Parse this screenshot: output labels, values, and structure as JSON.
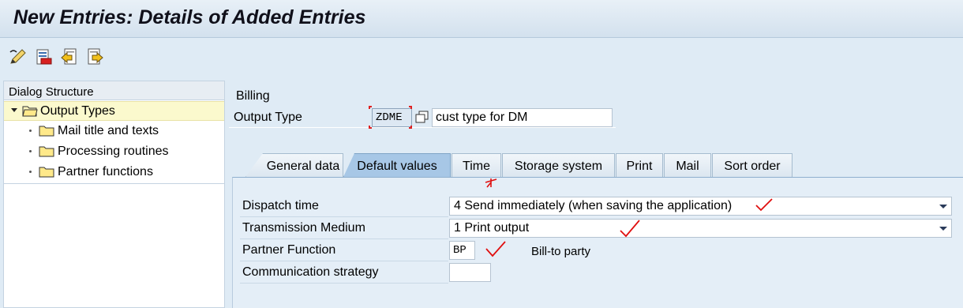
{
  "title": "New Entries: Details of Added Entries",
  "toolbar": {
    "icons": [
      "edit-display-icon",
      "delete-icon",
      "previous-entry-icon",
      "next-entry-icon"
    ]
  },
  "dialog_structure": {
    "header": "Dialog Structure",
    "items": [
      {
        "label": "Output Types",
        "selected": true
      },
      {
        "label": "Mail title and texts"
      },
      {
        "label": "Processing routines"
      },
      {
        "label": "Partner functions"
      }
    ]
  },
  "billing": {
    "label": "Billing",
    "output_type_label": "Output Type",
    "output_type_code": "ZDME",
    "output_type_desc": "cust type for DM"
  },
  "tabs": [
    {
      "label": "General data"
    },
    {
      "label": "Default values",
      "active": true
    },
    {
      "label": "Time"
    },
    {
      "label": "Storage system"
    },
    {
      "label": "Print"
    },
    {
      "label": "Mail"
    },
    {
      "label": "Sort order"
    }
  ],
  "form": {
    "dispatch_time_label": "Dispatch time",
    "dispatch_time_value": "4 Send immediately (when saving the application)",
    "transmission_label": "Transmission Medium",
    "transmission_value": "1 Print output",
    "partner_label": "Partner Function",
    "partner_value": "BP",
    "partner_desc": "Bill-to party",
    "comm_label": "Communication strategy",
    "comm_value": ""
  },
  "colors": {
    "annotation_red": "#e01010",
    "active_tab": "#a7c7e6",
    "background": "#dfebf5"
  }
}
